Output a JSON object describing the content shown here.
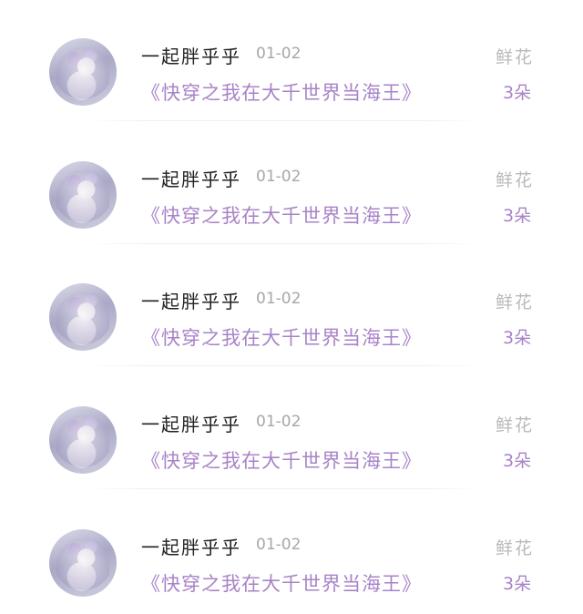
{
  "items": [
    {
      "username": "一起胖乎乎",
      "date": "01-02",
      "book_title": "《快穿之我在大千世界当海王》",
      "gift_type": "鲜花",
      "gift_count": "3朵"
    },
    {
      "username": "一起胖乎乎",
      "date": "01-02",
      "book_title": "《快穿之我在大千世界当海王》",
      "gift_type": "鲜花",
      "gift_count": "3朵"
    },
    {
      "username": "一起胖乎乎",
      "date": "01-02",
      "book_title": "《快穿之我在大千世界当海王》",
      "gift_type": "鲜花",
      "gift_count": "3朵"
    },
    {
      "username": "一起胖乎乎",
      "date": "01-02",
      "book_title": "《快穿之我在大千世界当海王》",
      "gift_type": "鲜花",
      "gift_count": "3朵"
    },
    {
      "username": "一起胖乎乎",
      "date": "01-02",
      "book_title": "《快穿之我在大千世界当海王》",
      "gift_type": "鲜花",
      "gift_count": "3朵"
    }
  ],
  "colors": {
    "accent": "#a883c8",
    "name": "#222222",
    "muted": "#a7a7a7"
  }
}
